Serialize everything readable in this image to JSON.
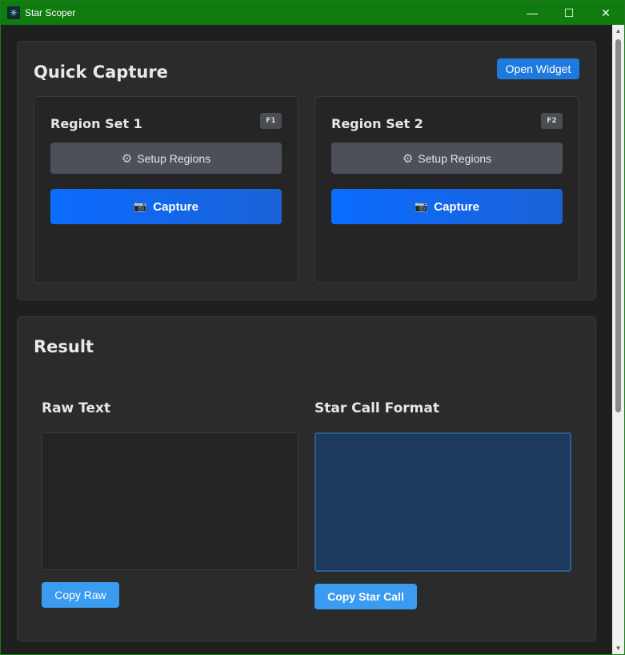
{
  "window": {
    "title": "Star Scoper",
    "app_icon": "snowflake-star-icon",
    "controls": {
      "minimize": "—",
      "maximize": "☐",
      "close": "✕"
    }
  },
  "quick_capture": {
    "title": "Quick Capture",
    "open_widget_label": "Open Widget",
    "region_sets": [
      {
        "title": "Region Set 1",
        "hotkey": "F1",
        "setup_label": "Setup Regions",
        "capture_label": "Capture"
      },
      {
        "title": "Region Set 2",
        "hotkey": "F2",
        "setup_label": "Setup Regions",
        "capture_label": "Capture"
      }
    ]
  },
  "result": {
    "title": "Result",
    "raw_text": {
      "label": "Raw Text",
      "value": "",
      "copy_label": "Copy Raw"
    },
    "star_call": {
      "label": "Star Call Format",
      "value": "",
      "copy_label": "Copy Star Call"
    }
  },
  "colors": {
    "titlebar": "#107c10",
    "accent": "#1f7ae0",
    "capture": "#0b6cff",
    "copy": "#3a9bf0",
    "star_call_bg": "#1d3a5c"
  },
  "icons": {
    "setup": "gear-icon",
    "capture": "camera-icon"
  }
}
